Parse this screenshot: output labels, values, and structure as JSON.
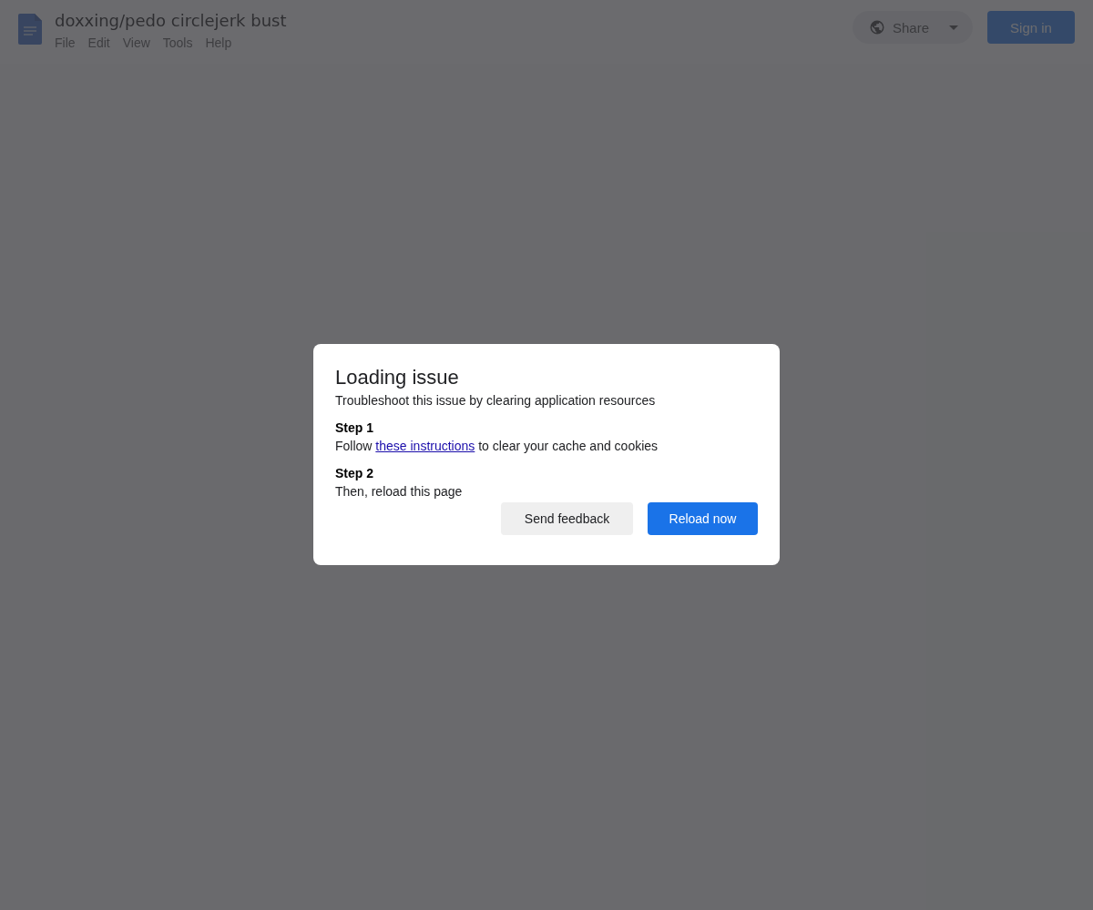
{
  "document": {
    "title": "doxxing/pedo circlejerk bust",
    "menu": [
      "File",
      "Edit",
      "View",
      "Tools",
      "Help"
    ],
    "share_button": "Share",
    "sign_in_button": "Sign in"
  },
  "dialog": {
    "title": "Loading issue",
    "subtitle": "Troubleshoot this issue by clearing application resources",
    "steps": [
      {
        "heading": "Step 1",
        "before": "Follow ",
        "link": "these instructions",
        "after": " to clear your cache and cookies"
      },
      {
        "heading": "Step 2",
        "before": "Then, reload this page"
      }
    ],
    "buttons": [
      {
        "label": "Send feedback",
        "kind": "secondary"
      },
      {
        "label": "Reload now",
        "kind": "primary"
      }
    ]
  }
}
